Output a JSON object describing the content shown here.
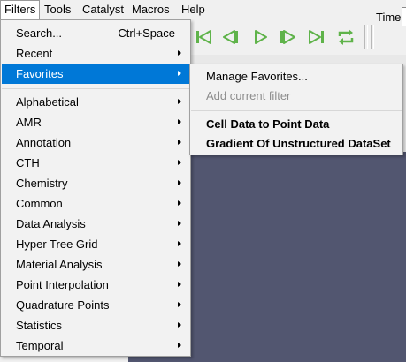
{
  "menubar": {
    "items": [
      "Filters",
      "Tools",
      "Catalyst",
      "Macros",
      "Help"
    ]
  },
  "toolbar": {
    "buttons": [
      {
        "icon": "first-frame-icon"
      },
      {
        "icon": "previous-frame-icon"
      },
      {
        "icon": "play-icon"
      },
      {
        "icon": "next-frame-icon"
      },
      {
        "icon": "last-frame-icon"
      },
      {
        "icon": "loop-icon"
      }
    ],
    "time_label": "Time:",
    "icon_color": "#5fb34a"
  },
  "filters_menu": {
    "search": {
      "label": "Search...",
      "shortcut": "Ctrl+Space"
    },
    "recent": {
      "label": "Recent"
    },
    "favorites": {
      "label": "Favorites"
    },
    "categories": [
      "Alphabetical",
      "AMR",
      "Annotation",
      "CTH",
      "Chemistry",
      "Common",
      "Data Analysis",
      "Hyper Tree Grid",
      "Material Analysis",
      "Point Interpolation",
      "Quadrature Points",
      "Statistics",
      "Temporal"
    ]
  },
  "favorites_submenu": {
    "manage": "Manage Favorites...",
    "add_current": "Add current filter",
    "items": [
      "Cell Data to Point Data",
      "Gradient Of Unstructured DataSet"
    ]
  },
  "colors": {
    "highlight": "#0078d7",
    "render_view": "#525670",
    "disabled_text": "#8d8d8d"
  }
}
